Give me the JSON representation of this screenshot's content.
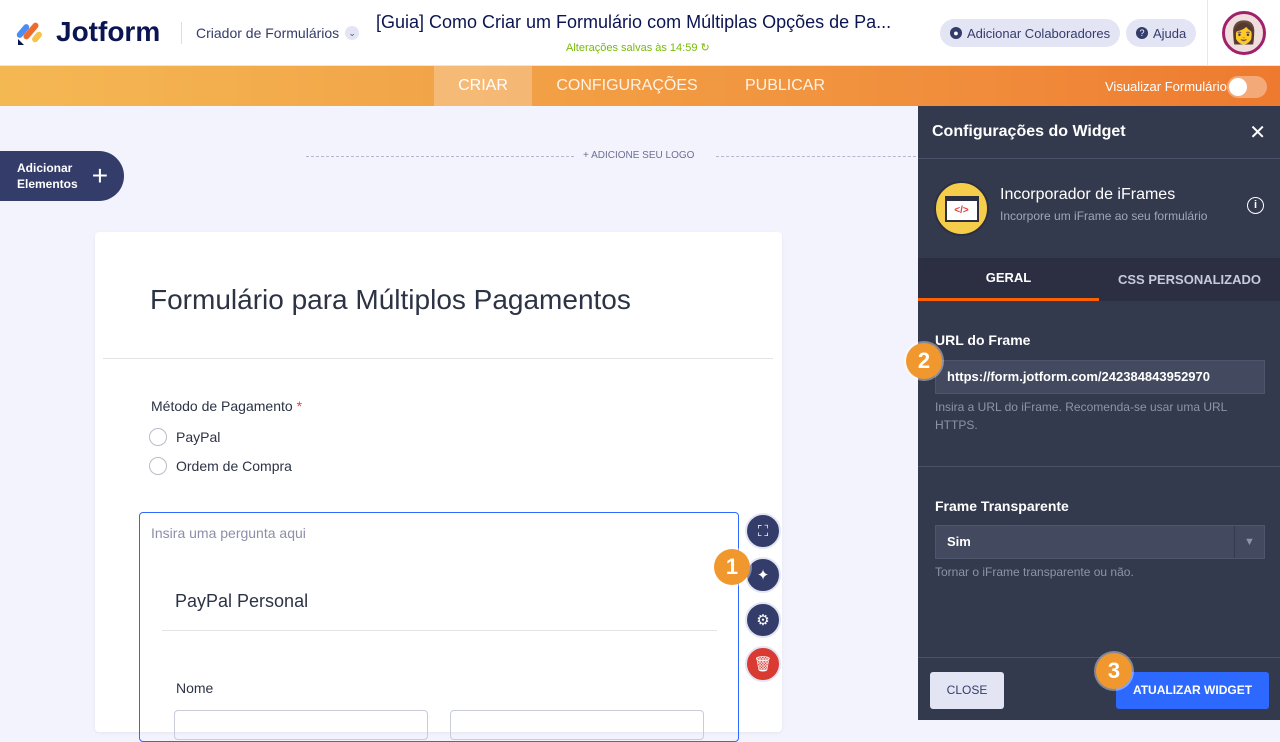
{
  "header": {
    "brand": "Jotform",
    "builder": "Criador de Formulários",
    "title": "[Guia] Como Criar um Formulário com Múltiplas Opções de Pa...",
    "saved": "Alterações salvas às 14:59 ↻",
    "add_collaborators": "Adicionar Colaboradores",
    "help": "Ajuda"
  },
  "nav": {
    "tabs": [
      "CRIAR",
      "CONFIGURAÇÕES",
      "PUBLICAR"
    ],
    "preview_label": "Visualizar Formulário",
    "preview_on": false
  },
  "canvas": {
    "add_elements": [
      "Adicionar",
      "Elementos"
    ],
    "add_logo": "+ ADICIONE SEU LOGO"
  },
  "form": {
    "title": "Formulário para Múltiplos Pagamentos",
    "question": "Método de Pagamento",
    "required": "*",
    "options": [
      "PayPal",
      "Ordem de Compra"
    ],
    "placeholder": "Insira uma pergunta aqui",
    "widget_heading": "PayPal Personal",
    "name_label": "Nome"
  },
  "badges": [
    "1",
    "2",
    "3"
  ],
  "panel": {
    "title": "Configurações do Widget",
    "widget_name": "Incorporador de iFrames",
    "widget_desc": "Incorpore um iFrame ao seu formulário",
    "widget_icon_text": "</>",
    "tabs": [
      "GERAL",
      "CSS PERSONALIZADO"
    ],
    "url_label": "URL do Frame",
    "url_value": "https://form.jotform.com/242384843952970",
    "url_help": "Insira a URL do iFrame. Recomenda-se usar uma URL HTTPS.",
    "transparent_label": "Frame Transparente",
    "transparent_value": "Sim",
    "transparent_help": "Tornar o iFrame transparente ou não.",
    "close": "CLOSE",
    "update": "ATUALIZAR WIDGET"
  }
}
